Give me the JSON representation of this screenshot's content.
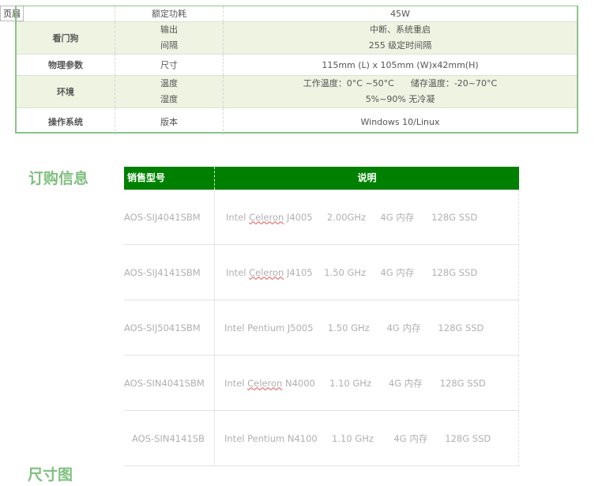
{
  "header_tag": "页眉",
  "spec_rows": [
    {
      "group": "",
      "items": [
        "额定功耗"
      ],
      "values": [
        "45W"
      ],
      "alt": false
    },
    {
      "group": "看门狗",
      "items": [
        "输出",
        "间隔"
      ],
      "values": [
        "中断、系统重启",
        "255 级定时间隔"
      ],
      "alt": true
    },
    {
      "group": "物理参数",
      "items": [
        "尺寸"
      ],
      "values": [
        "115mm (L) x 105mm (W)x42mm(H)"
      ],
      "alt": false
    },
    {
      "group": "环境",
      "items": [
        "温度",
        "湿度"
      ],
      "values": [
        "工作温度：0°C ~50°C      储存温度：-20~70°C",
        "5%~90%  无冷凝"
      ],
      "alt": true
    },
    {
      "group": "操作系统",
      "items": [
        "版本"
      ],
      "values": [
        "Windows 10/Linux"
      ],
      "alt": false
    }
  ],
  "order_title": "订购信息",
  "order_head": {
    "model": "销售型号",
    "desc": "说明"
  },
  "order_rows": [
    {
      "model": "AOS-SIJ4041SBM",
      "cpu_brand": "Intel ",
      "cpu_family": "Celeron",
      "cpu_model": " J4005",
      "spec": "     2.00GHz     4G 内存      128G SSD"
    },
    {
      "model": "AOS-SIJ4141SBM",
      "cpu_brand": "Intel ",
      "cpu_family": "Celeron",
      "cpu_model": " J4105",
      "spec": "    1.50 GHz     4G 内存      128G SSD"
    },
    {
      "model": "AOS-SIJ5041SBM",
      "cpu_brand": "Intel ",
      "cpu_family": "Pentium",
      "cpu_model": " J5005",
      "spec": "     1.50 GHz      4G 内存      128G SSD"
    },
    {
      "model": "AOS-SIN4041SBM",
      "cpu_brand": "Intel ",
      "cpu_family": "Celeron",
      "cpu_model": " N4000",
      "spec": "     1.10 GHz      4G 内存      128G SSD"
    },
    {
      "model": "AOS-SIN4141SB",
      "cpu_brand": "Intel ",
      "cpu_family": "Pentium",
      "cpu_model": " N4100",
      "spec": "     1.10 GHz       4G 内存      128G SSD"
    }
  ],
  "size_title": "尺寸图"
}
